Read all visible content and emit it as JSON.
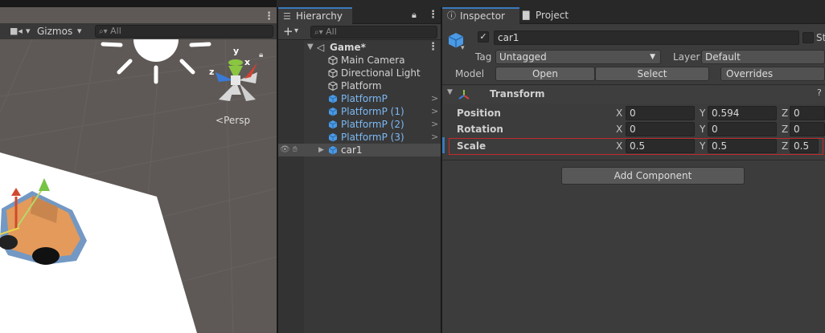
{
  "scene": {
    "gizmos_label": "Gizmos",
    "search_placeholder": "All",
    "persp_label": "Persp",
    "axis_y": "y",
    "axis_x": "x",
    "axis_z": "z"
  },
  "hierarchy": {
    "tab_label": "Hierarchy",
    "search_placeholder": "All",
    "scene_name": "Game*",
    "items": [
      {
        "label": "Main Camera"
      },
      {
        "label": "Directional Light"
      },
      {
        "label": "Platform"
      },
      {
        "label": "PlatformP"
      },
      {
        "label": "PlatformP (1)"
      },
      {
        "label": "PlatformP (2)"
      },
      {
        "label": "PlatformP (3)"
      },
      {
        "label": "car1"
      }
    ]
  },
  "inspector": {
    "tab_inspector": "Inspector",
    "tab_project": "Project",
    "object_name": "car1",
    "static_label": "St",
    "tag_label": "Tag",
    "tag_value": "Untagged",
    "layer_label": "Layer",
    "layer_value": "Default",
    "model_label": "Model",
    "model_open": "Open",
    "model_select": "Select",
    "model_overrides": "Overrides",
    "transform_title": "Transform",
    "rows": [
      {
        "label": "Position",
        "x": "0",
        "y": "0.594",
        "z": "0"
      },
      {
        "label": "Rotation",
        "x": "0",
        "y": "0",
        "z": "0"
      },
      {
        "label": "Scale",
        "x": "0.5",
        "y": "0.5",
        "z": "0.5"
      }
    ],
    "axis_x": "X",
    "axis_y": "Y",
    "axis_z": "Z",
    "add_component": "Add Component"
  },
  "colors": {
    "selection_outline": "#c42b2b",
    "prefab_text": "#7cb9f5",
    "tab_accent": "#3a79bb"
  }
}
